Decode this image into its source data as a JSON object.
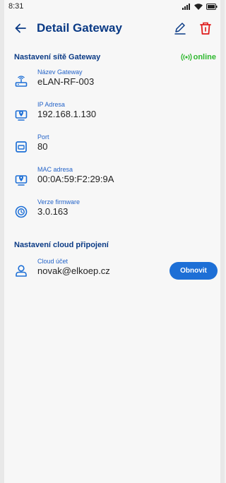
{
  "status_bar": {
    "time": "8:31"
  },
  "header": {
    "title": "Detail Gateway"
  },
  "network_section": {
    "title": "Nastavení sítě Gateway",
    "status_text": "online",
    "fields": [
      {
        "label": "Název Gateway",
        "value": "eLAN-RF-003",
        "icon": "router-icon"
      },
      {
        "label": "IP Adresa",
        "value": "192.168.1.130",
        "icon": "location-monitor-icon"
      },
      {
        "label": "Port",
        "value": "80",
        "icon": "monitor-icon"
      },
      {
        "label": "MAC adresa",
        "value": "00:0A:59:F2:29:9A",
        "icon": "location-monitor-icon"
      },
      {
        "label": "Verze firmware",
        "value": "3.0.163",
        "icon": "firmware-icon"
      }
    ]
  },
  "cloud_section": {
    "title": "Nastavení cloud připojení",
    "account_label": "Cloud účet",
    "account_value": "novak@elkoep.cz",
    "refresh_label": "Obnovit"
  },
  "colors": {
    "primary_dark": "#0a3a85",
    "accent": "#1d6fd6",
    "online": "#2eb82e",
    "delete": "#e01b1b"
  }
}
